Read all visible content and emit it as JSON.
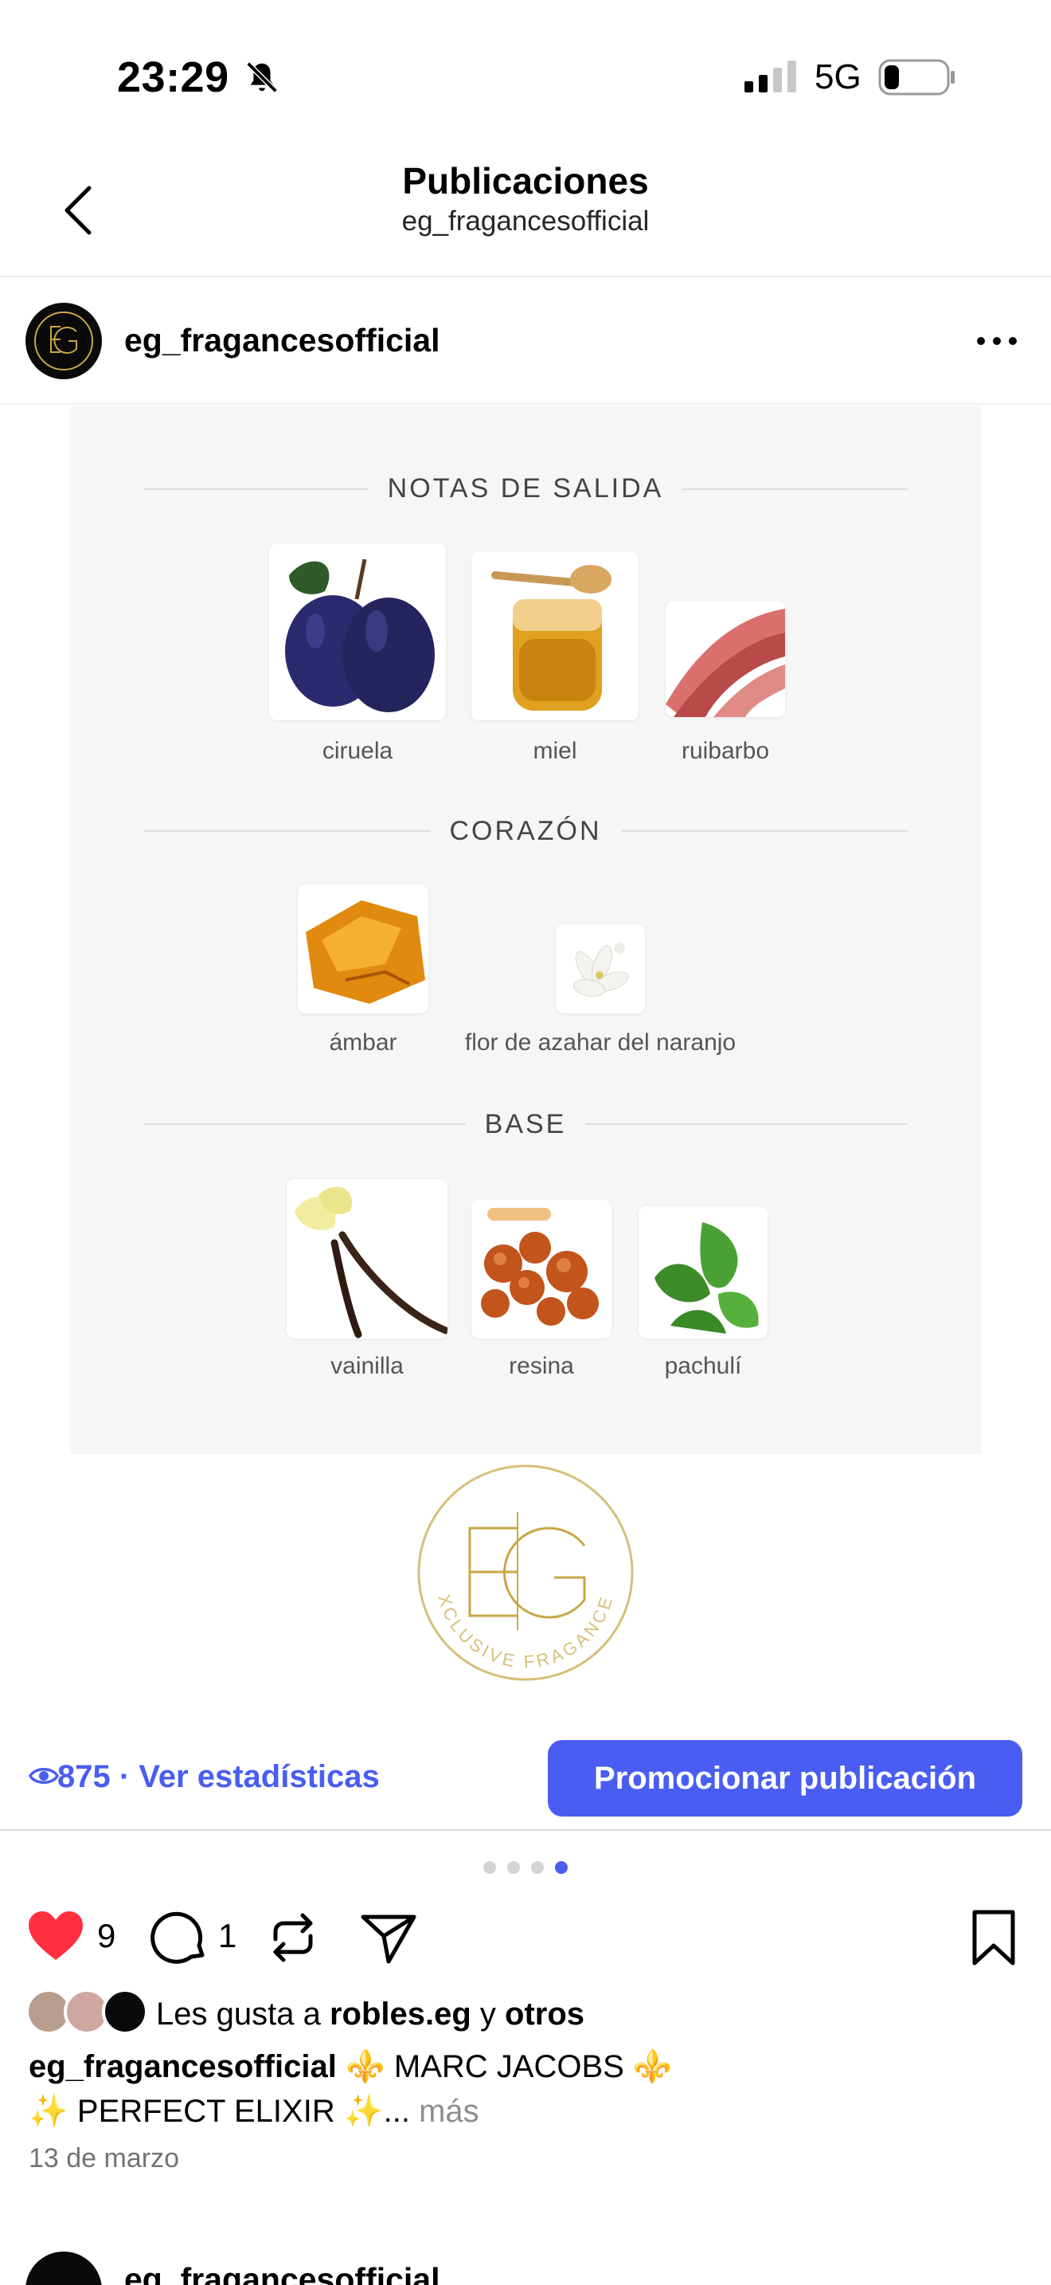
{
  "status_bar": {
    "time": "23:29",
    "network": "5G"
  },
  "header": {
    "title": "Publicaciones",
    "subtitle": "eg_fragancesofficial"
  },
  "post": {
    "username": "eg_fragancesofficial",
    "image": {
      "sections": [
        {
          "title": "NOTAS DE SALIDA",
          "notes": [
            "ciruela",
            "miel",
            "ruibarbo"
          ]
        },
        {
          "title": "CORAZÓN",
          "notes": [
            "ámbar",
            "flor de azahar del naranjo"
          ]
        },
        {
          "title": "BASE",
          "notes": [
            "vainilla",
            "resina",
            "pachulí"
          ]
        }
      ],
      "logo_text": "EXCLUSIVE FRAGANCES"
    },
    "stats": {
      "views": "875",
      "separator": "·",
      "link": "Ver estadísticas"
    },
    "promote_label": "Promocionar publicación",
    "carousel": {
      "total": 4,
      "active": 4
    },
    "likes_count": "9",
    "comments_count": "1",
    "likes_text": {
      "prefix": "Les gusta a",
      "user": "robles.eg",
      "conj": "y",
      "others": "otros"
    },
    "caption": {
      "username": "eg_fragancesofficial",
      "line1": "⚜️ MARC JACOBS ⚜️",
      "line2": "✨ PERFECT ELIXIR ✨...",
      "more": "más"
    },
    "date": "13 de marzo"
  },
  "next_post": {
    "username": "eg_fragancesofficial"
  },
  "colors": {
    "accent": "#4a5df2",
    "like": "#ff3040",
    "gold": "#c9a646"
  }
}
